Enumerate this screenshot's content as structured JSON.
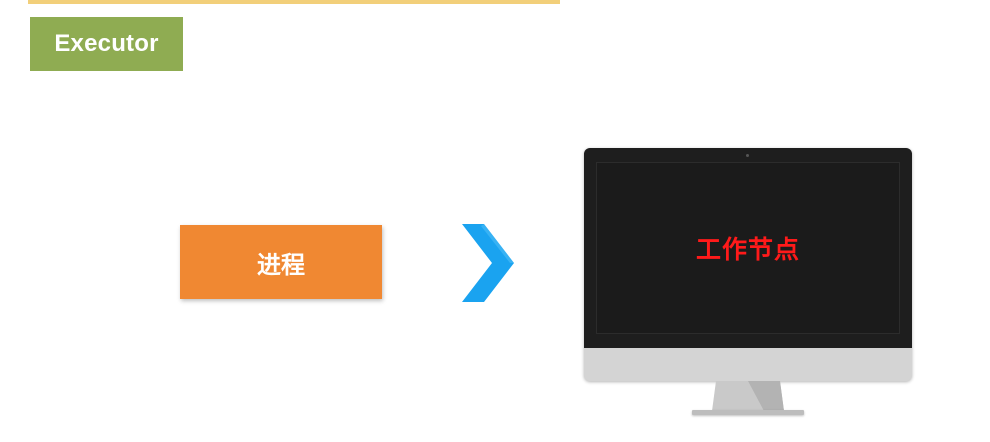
{
  "title": "Executor",
  "process": {
    "label": "进程"
  },
  "arrow": {
    "icon": "chevron-right-icon",
    "color": "#1aa3f0"
  },
  "monitor": {
    "icon": "desktop-monitor-icon",
    "screen_label": "工作节点",
    "screen_label_color": "#ff1a1a"
  },
  "colors": {
    "title_bg": "#8fac52",
    "process_bg": "#f08832",
    "top_rule": "#f2cf7a"
  }
}
